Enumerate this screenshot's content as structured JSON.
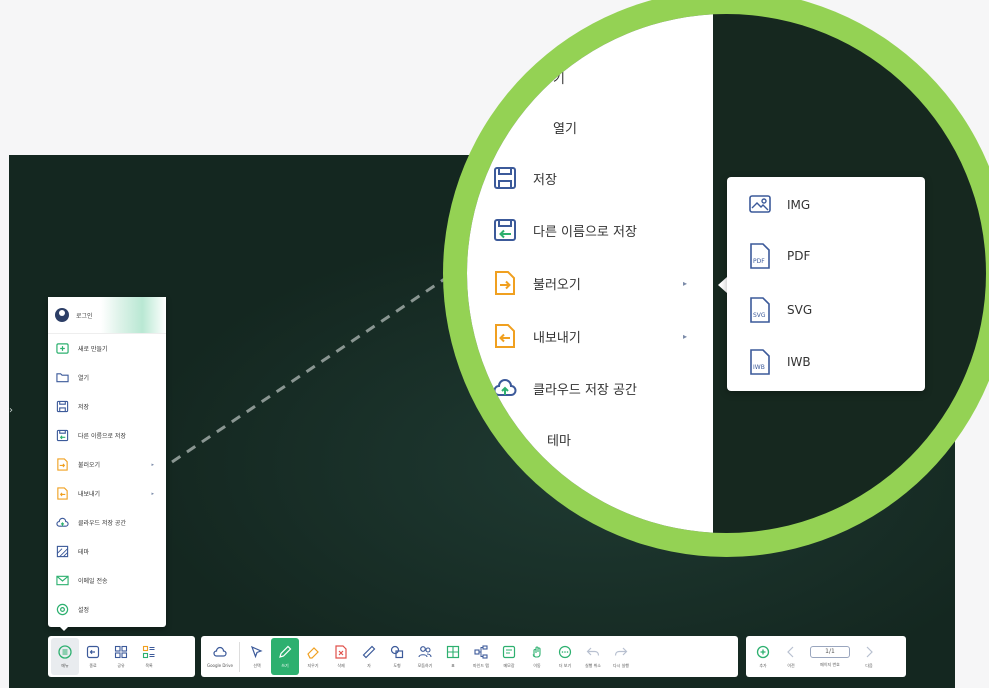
{
  "colors": {
    "board": "#142720",
    "accent_green": "#2db06f",
    "zoom_ring": "#94d254",
    "icon_blue": "#3c5a9a",
    "icon_orange": "#f0a020",
    "icon_green": "#2db06f"
  },
  "menu": {
    "login_label": "로그인",
    "items": [
      {
        "label": "새로 만들기",
        "icon": "new-file-icon"
      },
      {
        "label": "열기",
        "icon": "folder-open-icon"
      },
      {
        "label": "저장",
        "icon": "save-icon"
      },
      {
        "label": "다른 이름으로 저장",
        "icon": "save-as-icon"
      },
      {
        "label": "불러오기",
        "icon": "import-icon",
        "has_submenu": true
      },
      {
        "label": "내보내기",
        "icon": "export-icon",
        "has_submenu": true
      },
      {
        "label": "클라우드 저장 공간",
        "icon": "cloud-upload-icon"
      },
      {
        "label": "테마",
        "icon": "theme-icon"
      },
      {
        "label": "이메일 전송",
        "icon": "email-icon"
      },
      {
        "label": "설정",
        "icon": "settings-icon"
      }
    ],
    "submenu_arrow": "▸"
  },
  "zoom": {
    "partial_top_label": "기",
    "items": [
      {
        "label": "열기"
      },
      {
        "label": "저장"
      },
      {
        "label": "다른 이름으로 저장"
      },
      {
        "label": "불러오기"
      },
      {
        "label": "내보내기"
      },
      {
        "label": "클라우드 저장 공간"
      },
      {
        "label": "테마"
      }
    ],
    "export_formats": [
      "IMG",
      "PDF",
      "SVG",
      "IWB"
    ]
  },
  "toolbar": {
    "left": [
      {
        "label": "메뉴",
        "icon": "menu-icon"
      },
      {
        "label": "종료",
        "icon": "exit-icon"
      },
      {
        "label": "공유",
        "icon": "share-icon"
      },
      {
        "label": "목록",
        "icon": "list-icon"
      }
    ],
    "drive": {
      "label": "Google Drive",
      "icon": "google-drive-icon"
    },
    "tools": [
      {
        "label": "선택",
        "icon": "select-icon"
      },
      {
        "label": "쓰기",
        "icon": "pen-icon",
        "active": true
      },
      {
        "label": "지우기",
        "icon": "eraser-icon"
      },
      {
        "label": "삭제",
        "icon": "delete-icon"
      },
      {
        "label": "자",
        "icon": "ruler-icon"
      },
      {
        "label": "도형",
        "icon": "shapes-icon"
      },
      {
        "label": "모둠하기",
        "icon": "group-icon"
      },
      {
        "label": "표",
        "icon": "table-icon"
      },
      {
        "label": "마인드 맵",
        "icon": "mindmap-icon"
      },
      {
        "label": "메모장",
        "icon": "memo-icon"
      },
      {
        "label": "이동",
        "icon": "move-hand-icon"
      },
      {
        "label": "더 보기",
        "icon": "more-icon"
      },
      {
        "label": "실행 취소",
        "icon": "undo-icon"
      },
      {
        "label": "다시 실행",
        "icon": "redo-icon"
      }
    ],
    "pages": {
      "add_label": "추가",
      "prev_label": "이전",
      "page_value": "1/1",
      "page_caption": "페이지 번호",
      "next_label": "다음"
    }
  }
}
